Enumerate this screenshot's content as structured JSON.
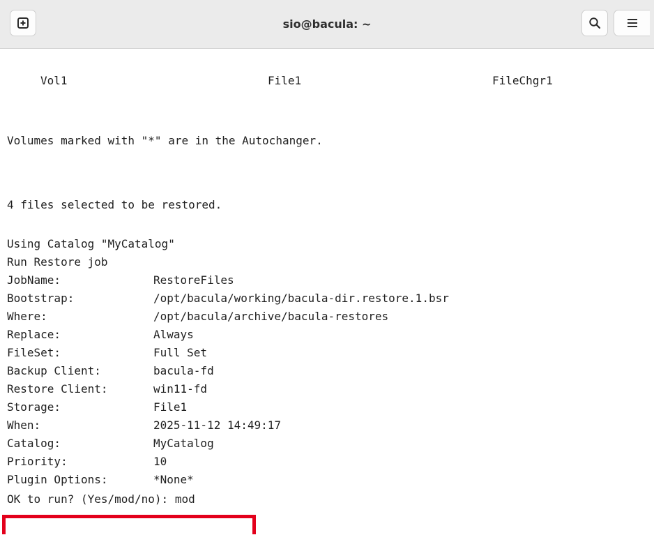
{
  "window": {
    "title": "sio@bacula: ~",
    "new_tab_icon": "new-tab-icon",
    "search_icon": "search-icon",
    "menu_icon": "hamburger-menu-icon"
  },
  "terminal": {
    "volume_row": {
      "volume": "Vol1",
      "storage": "File1",
      "device": "FileChgr1"
    },
    "autochanger_note": "Volumes marked with \"*\" are in the Autochanger.",
    "files_selected": "4 files selected to be restored.",
    "using_catalog": "Using Catalog \"MyCatalog\"",
    "run_restore": "Run Restore job",
    "job_fields": [
      {
        "key": "JobName:",
        "value": "RestoreFiles"
      },
      {
        "key": "Bootstrap:",
        "value": "/opt/bacula/working/bacula-dir.restore.1.bsr"
      },
      {
        "key": "Where:",
        "value": "/opt/bacula/archive/bacula-restores"
      },
      {
        "key": "Replace:",
        "value": "Always"
      },
      {
        "key": "FileSet:",
        "value": "Full Set"
      },
      {
        "key": "Backup Client:",
        "value": "bacula-fd"
      },
      {
        "key": "Restore Client:",
        "value": "win11-fd"
      },
      {
        "key": "Storage:",
        "value": "File1"
      },
      {
        "key": "When:",
        "value": "2025-11-12 14:49:17"
      },
      {
        "key": "Catalog:",
        "value": "MyCatalog"
      },
      {
        "key": "Priority:",
        "value": "10"
      },
      {
        "key": "Plugin Options:",
        "value": "*None*"
      }
    ],
    "prompt": "OK to run? (Yes/mod/no): mod",
    "highlight_color": "#e3001b"
  }
}
